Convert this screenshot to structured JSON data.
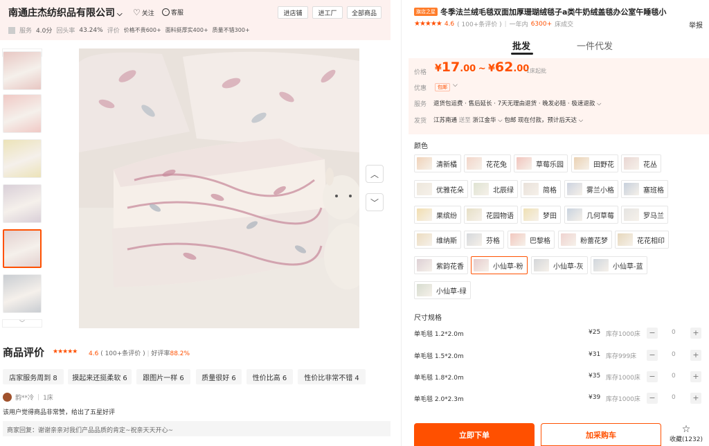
{
  "shop": {
    "name": "南通庄杰纺织品有限公司",
    "follow": "关注",
    "service": "客服",
    "buttons": [
      "进店铺",
      "进工厂",
      "全部商品"
    ],
    "service_label": "服务",
    "service_score": "4.0分",
    "repeat_label": "回头率",
    "repeat_value": "43.24%",
    "eval_label": "评价",
    "eval_tags": [
      "价格不贵600+",
      "面料挺厚实400+",
      "质量不错300+"
    ]
  },
  "gallery": {
    "swatch_colors": [
      "#e8c7c3",
      "#f0c9c5",
      "#ece3b8",
      "#d9cfd8",
      "#e3d0cf",
      "#c9cdd2"
    ],
    "selected_index": 4
  },
  "reviews": {
    "title": "商品评价",
    "score": "4.6",
    "count": "( 100+条评价 )",
    "good_rate_label": "好评率",
    "good_rate": "88.2%",
    "tags": [
      "店家服务周到 8",
      "摸起来还挺柔软 6",
      "跟图片一样 6",
      "质量很好 6",
      "性价比高 6",
      "性价比非常不错 4"
    ],
    "user": "韵**冷",
    "qty": "1床",
    "text": "该用户觉得商品非常赞，给出了五星好评",
    "reply": "商家回复：谢谢亲亲对我们产品品质的肯定~祝亲天天开心~"
  },
  "product": {
    "badge": "旗店之星",
    "title": "冬季法兰绒毛毯双面加厚珊瑚绒毯子a类牛奶绒盖毯办公室午睡毯小",
    "report": "举报",
    "score": "4.6",
    "reviews": "( 100+条评价 )",
    "sales_prefix": "一年内",
    "sales_value": "6300+",
    "sales_suffix": "床成交"
  },
  "tabs": [
    "批发",
    "一件代发"
  ],
  "price": {
    "label": "价格",
    "low_int": "17",
    "low_dec": ".00",
    "high_int": "62",
    "high_dec": ".00",
    "yen": "¥",
    "sep": "~",
    "unit": "1床起批",
    "promo_label": "优惠",
    "promo_tag": "包邮",
    "service_label": "服务",
    "service_text": "退货包运费 · 售后延长 · 7天无理由退货 · 晚发必赔 · 极速退款",
    "ship_label": "发货",
    "ship_from": "江苏南通",
    "ship_to_label": "送至",
    "ship_to": "浙江金华",
    "ship_free": "包邮",
    "ship_eta": "现在付款，预计后天达"
  },
  "colors": {
    "label": "颜色",
    "items": [
      {
        "name": "清新橘",
        "swatch": "#f0d2b9"
      },
      {
        "name": "花花兔",
        "swatch": "#f2d5c9"
      },
      {
        "name": "草莓乐园",
        "swatch": "#f1c4bd"
      },
      {
        "name": "田野花",
        "swatch": "#ead1b3"
      },
      {
        "name": "花丛",
        "swatch": "#e9d6d3"
      },
      {
        "name": "优雅花朵",
        "swatch": "#ede7dc"
      },
      {
        "name": "北辰绿",
        "swatch": "#dfe3d2"
      },
      {
        "name": "简格",
        "swatch": "#e9e1da"
      },
      {
        "name": "雾兰小格",
        "swatch": "#cdd3e0"
      },
      {
        "name": "塞班格",
        "swatch": "#c7d0dc"
      },
      {
        "name": "果缤纷",
        "swatch": "#f2deb0"
      },
      {
        "name": "花园物语",
        "swatch": "#e6dfc6"
      },
      {
        "name": "梦田",
        "swatch": "#efe0b4"
      },
      {
        "name": "几何草莓",
        "swatch": "#c9d3df"
      },
      {
        "name": "罗马兰",
        "swatch": "#e5e4e2"
      },
      {
        "name": "维纳斯",
        "swatch": "#ecdcc0"
      },
      {
        "name": "芬格",
        "swatch": "#d5d8dc"
      },
      {
        "name": "巴黎格",
        "swatch": "#f2c8bf"
      },
      {
        "name": "粉蕾花梦",
        "swatch": "#efd3d0"
      },
      {
        "name": "花花相印",
        "swatch": "#e6d7bc"
      },
      {
        "name": "紫韵花香",
        "swatch": "#ddd0d5"
      },
      {
        "name": "小仙草-粉",
        "swatch": "#e6cccd"
      },
      {
        "name": "小仙草-灰",
        "swatch": "#d4d6d9"
      },
      {
        "name": "小仙草-蓝",
        "swatch": "#d0d6dd"
      },
      {
        "name": "小仙草-绿",
        "swatch": "#d6dccf"
      }
    ],
    "selected": "小仙草-粉"
  },
  "sizes": {
    "label": "尺寸规格",
    "rows": [
      {
        "name": "单毛毯 1.2*2.0m",
        "price": "¥25",
        "stock": "库存1000床",
        "qty": "0"
      },
      {
        "name": "单毛毯 1.5*2.0m",
        "price": "¥31",
        "stock": "库存999床",
        "qty": "0"
      },
      {
        "name": "单毛毯 1.8*2.0m",
        "price": "¥35",
        "stock": "库存1000床",
        "qty": "0"
      },
      {
        "name": "单毛毯 2.0*2.3m",
        "price": "¥39",
        "stock": "库存1000床",
        "qty": "0"
      }
    ]
  },
  "actions": {
    "order": "立即下单",
    "cart": "加采购车",
    "fav": "收藏(1232)"
  }
}
